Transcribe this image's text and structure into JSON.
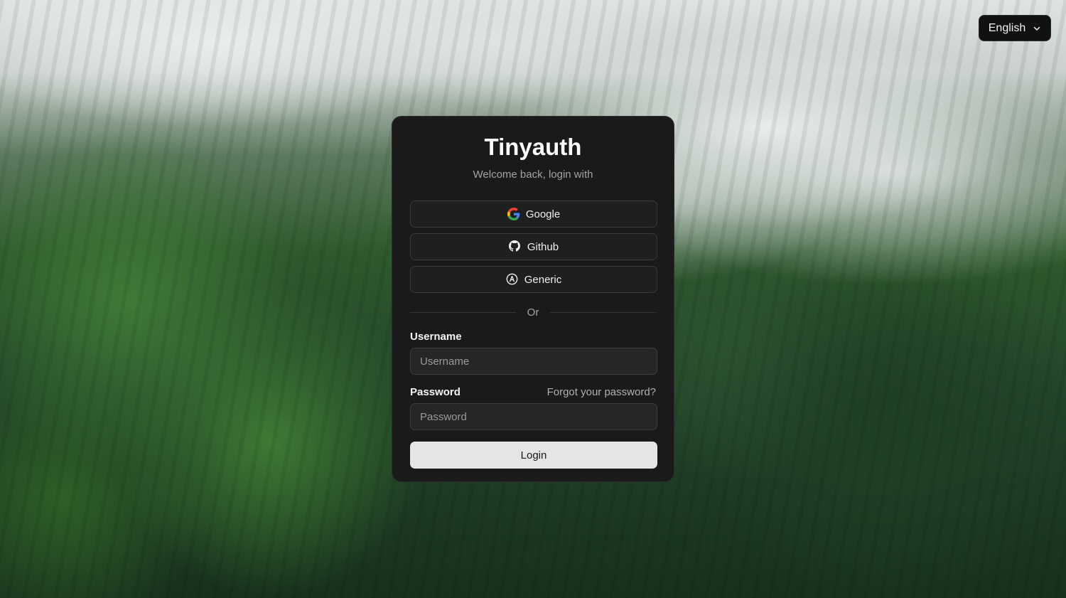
{
  "language": {
    "selected": "English",
    "icon": "chevron-down-icon"
  },
  "card": {
    "title": "Tinyauth",
    "subtitle": "Welcome back, login with"
  },
  "oauth": [
    {
      "label": "Google",
      "icon": "google-icon"
    },
    {
      "label": "Github",
      "icon": "github-icon"
    },
    {
      "label": "Generic",
      "icon": "openid-icon"
    }
  ],
  "divider": {
    "text": "Or"
  },
  "form": {
    "username_label": "Username",
    "username_placeholder": "Username",
    "password_label": "Password",
    "password_placeholder": "Password",
    "forgot_link": "Forgot your password?",
    "login_label": "Login"
  },
  "colors": {
    "card_bg": "#1a1a1a",
    "button_bg": "#1f1f1f",
    "login_bg": "#e5e5e5",
    "google_blue": "#4285F4",
    "google_red": "#EA4335",
    "google_yellow": "#FBBC05",
    "google_green": "#34A853"
  }
}
